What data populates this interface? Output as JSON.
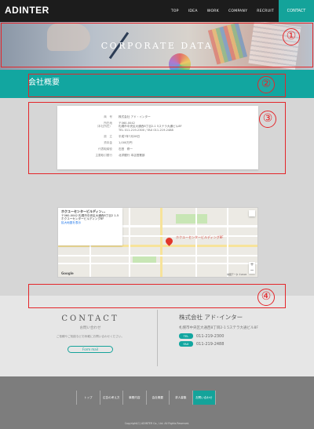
{
  "header": {
    "logo": "ADINTER",
    "nav": [
      "TOP",
      "IDEA",
      "WORK",
      "COMPANY",
      "RECRUIT"
    ],
    "contact": "CONTACT"
  },
  "hero": {
    "title": "CORPORATE DATA"
  },
  "section": {
    "title": "会社概要"
  },
  "company_info": {
    "rows": [
      {
        "label": "商　号",
        "value": "株式会社 アド・インター"
      },
      {
        "label": "所在地\n（本社所在）",
        "value": "〒060-0042\n札幌市中央区大通西8丁目2-1 5ステラ大通ビル8F\nTEL 011-219-2300 / FAX 011-219-2488"
      },
      {
        "label": "設　立",
        "value": "平成7年7月28日"
      },
      {
        "label": "資本金",
        "value": "1,000万円"
      },
      {
        "label": "代表取締役",
        "value": "石田　修一"
      },
      {
        "label": "主要取引銀行",
        "value": "北洋銀行 本店営業部"
      }
    ]
  },
  "map": {
    "place_name": "ホクユーセンタービルディン...",
    "address": "〒060-0042 札幌市中央区大通西8丁目2 1-5 ホクユーセンタービルディング8F",
    "link": "拡大地図を表示",
    "pin_label": "ホクユーセンタービルディング8F",
    "google": "Google",
    "zoom_in": "+",
    "zoom_out": "−",
    "footnote": "地図データ ©2018"
  },
  "contact": {
    "heading": "CONTACT",
    "sub": "お問い合わせ",
    "desc": "ご依頼やご相談などお気軽にお問い合わせください。",
    "form_button": "Form mail",
    "company_name": "株式会社 アド･インター",
    "address": "札幌市中央区大通西8丁目2-1 5ステラ大通ビル8F",
    "phones": [
      {
        "label": "TEL",
        "number": "011-219-2300"
      },
      {
        "label": "FAX",
        "number": "011-219-2488"
      }
    ]
  },
  "footer": {
    "nav": [
      "トップ",
      "広告の考え方",
      "事業内容",
      "会社概要",
      "求人募集",
      "お問い合わせ"
    ],
    "copyright": "Copyright(C) ADINTER Co., Ltd. All Rights Reserved."
  },
  "annotations": [
    "①",
    "②",
    "③",
    "④"
  ],
  "colors": {
    "accent": "#14a39a",
    "annotation": "#e4262a",
    "header_bg": "#1c1c1c",
    "footer_bg": "#7d7d7d"
  }
}
